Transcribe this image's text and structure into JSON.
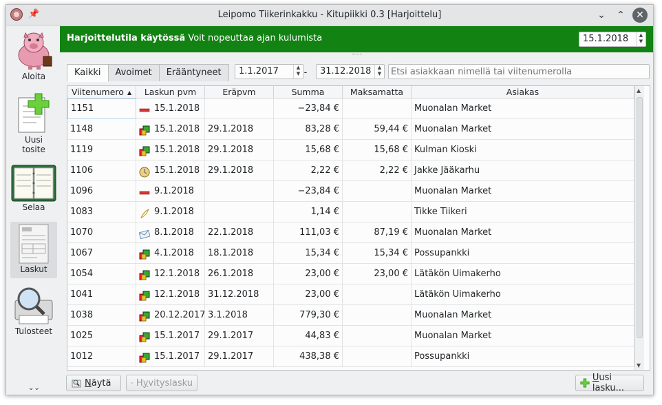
{
  "window": {
    "title": "Leipomo Tiikerinkakku - Kitupiikki 0.3 [Harjoittelu]"
  },
  "sidebar": {
    "items": [
      {
        "label": "Aloita",
        "icon": "piggy-bank-icon"
      },
      {
        "label": "Uusi\ntosite",
        "icon": "new-document-icon"
      },
      {
        "label": "Selaa",
        "icon": "ledger-book-icon"
      },
      {
        "label": "Laskut",
        "icon": "invoice-icon"
      },
      {
        "label": "Tulosteet",
        "icon": "print-preview-icon"
      }
    ],
    "active": "Laskut"
  },
  "banner": {
    "bold": "Harjoittelutila käytössä",
    "text": " Voit nopeuttaa ajan kulumista",
    "date": "15.1.2018",
    "color": "#128212"
  },
  "filters": {
    "tabs": [
      "Kaikki",
      "Avoimet",
      "Erääntyneet"
    ],
    "active_tab": "Kaikki",
    "date_from": "1.1.2017",
    "date_sep": "-",
    "date_to": "31.12.2018",
    "search_placeholder": "Etsi asiakkaan nimellä tai viitenumerolla"
  },
  "table": {
    "columns": [
      "Viitenumero",
      "Laskun pvm",
      "Eräpvm",
      "Summa",
      "Maksamatta",
      "Asiakas"
    ],
    "sorted_column": "Viitenumero",
    "rows": [
      {
        "ref": "1151",
        "icon": "red-minus-icon",
        "date": "15.1.2018",
        "due": "",
        "sum": "−23,84 €",
        "unpaid": "",
        "customer": "Muonalan Market"
      },
      {
        "ref": "1148",
        "icon": "colored-cube-icon",
        "date": "15.1.2018",
        "due": "29.1.2018",
        "sum": "83,28 €",
        "unpaid": "59,44 €",
        "customer": "Muonalan Market"
      },
      {
        "ref": "1119",
        "icon": "colored-cube-icon",
        "date": "15.1.2018",
        "due": "29.1.2018",
        "sum": "15,68 €",
        "unpaid": "15,68 €",
        "customer": "Kulman Kioski"
      },
      {
        "ref": "1106",
        "icon": "clock-coin-icon",
        "date": "15.1.2018",
        "due": "29.1.2018",
        "sum": "2,22 €",
        "unpaid": "2,22 €",
        "customer": "Jakke Jääkarhu"
      },
      {
        "ref": "1096",
        "icon": "red-minus-icon",
        "date": "9.1.2018",
        "due": "",
        "sum": "−23,84 €",
        "unpaid": "",
        "customer": "Muonalan Market"
      },
      {
        "ref": "1083",
        "icon": "feather-icon",
        "date": "9.1.2018",
        "due": "",
        "sum": "1,14 €",
        "unpaid": "",
        "customer": "Tikke Tiikeri"
      },
      {
        "ref": "1070",
        "icon": "envelope-icon",
        "date": "8.1.2018",
        "due": "22.1.2018",
        "sum": "111,03 €",
        "unpaid": "87,19 €",
        "customer": "Muonalan Market"
      },
      {
        "ref": "1067",
        "icon": "colored-cube-icon",
        "date": "4.1.2018",
        "due": "18.1.2018",
        "sum": "15,34 €",
        "unpaid": "15,34 €",
        "customer": "Possupankki"
      },
      {
        "ref": "1054",
        "icon": "colored-cube-icon",
        "date": "12.1.2018",
        "due": "26.1.2018",
        "sum": "23,00 €",
        "unpaid": "23,00 €",
        "customer": "Lätäkön Uimakerho"
      },
      {
        "ref": "1041",
        "icon": "colored-cube-icon",
        "date": "12.1.2018",
        "due": "31.12.2018",
        "sum": "23,00 €",
        "unpaid": "",
        "customer": "Lätäkön Uimakerho"
      },
      {
        "ref": "1038",
        "icon": "colored-cube-icon",
        "date": "20.12.2017",
        "due": "3.1.2018",
        "sum": "779,30 €",
        "unpaid": "",
        "customer": "Muonalan Market"
      },
      {
        "ref": "1025",
        "icon": "colored-cube-icon",
        "date": "15.1.2017",
        "due": "29.1.2017",
        "sum": "44,83 €",
        "unpaid": "",
        "customer": "Muonalan Market"
      },
      {
        "ref": "1012",
        "icon": "colored-cube-icon",
        "date": "15.1.2017",
        "due": "29.1.2017",
        "sum": "438,38 €",
        "unpaid": "",
        "customer": "Possupankki"
      }
    ]
  },
  "buttons": {
    "show_n": "N",
    "show_rest": "äytä",
    "credit_pre": "H",
    "credit_u": "y",
    "credit_rest": "vityslasku",
    "new_u": "U",
    "new_rest": "usi lasku..."
  }
}
